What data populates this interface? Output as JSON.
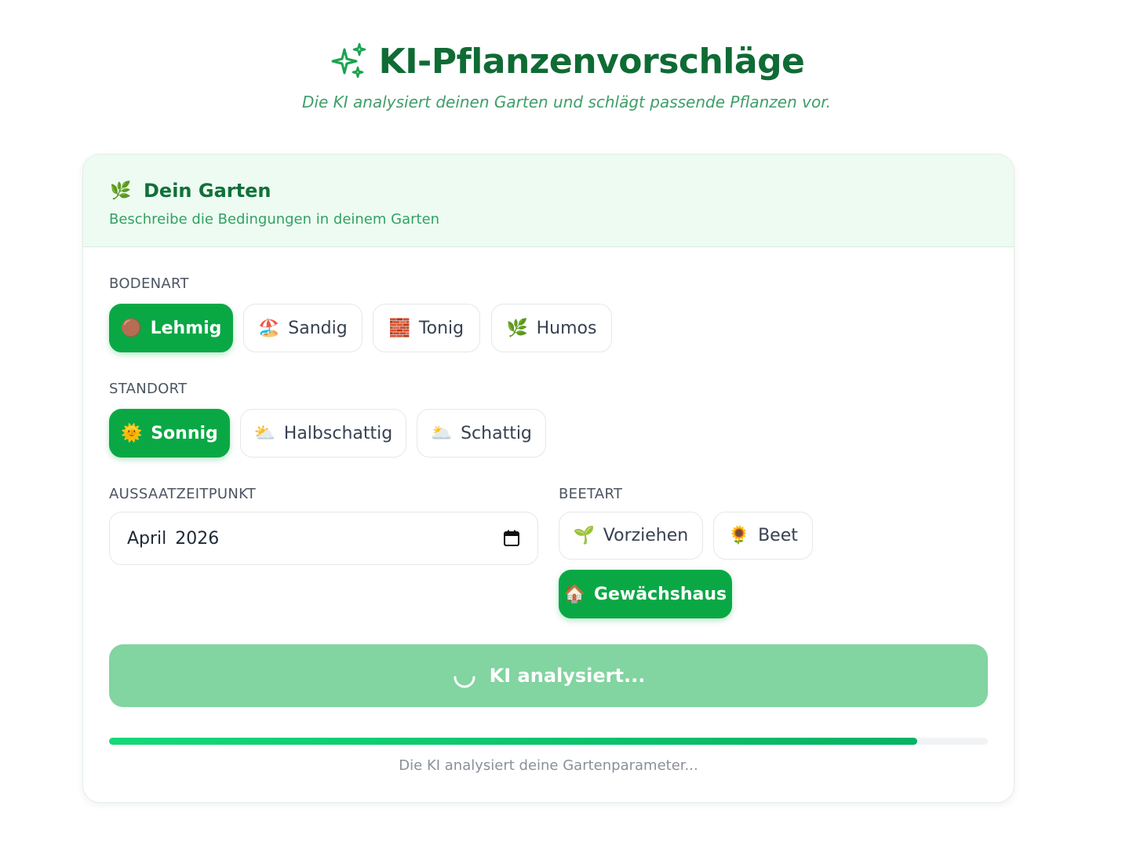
{
  "header": {
    "icon": "sparkles-icon",
    "title": "KI-Pflanzenvorschläge",
    "subtitle": "Die KI analysiert deinen Garten und schlägt passende Pflanzen vor."
  },
  "card": {
    "icon": "🌿",
    "title": "Dein Garten",
    "description": "Beschreibe die Bedingungen in deinem Garten"
  },
  "soil": {
    "label": "BODENART",
    "options": [
      {
        "emoji": "🟤",
        "label": "Lehmig",
        "active": true
      },
      {
        "emoji": "🏖️",
        "label": "Sandig",
        "active": false
      },
      {
        "emoji": "🧱",
        "label": "Tonig",
        "active": false
      },
      {
        "emoji": "🌿",
        "label": "Humos",
        "active": false
      }
    ]
  },
  "location": {
    "label": "STANDORT",
    "options": [
      {
        "emoji": "🌞",
        "label": "Sonnig",
        "active": true
      },
      {
        "emoji": "⛅",
        "label": "Halbschattig",
        "active": false
      },
      {
        "emoji": "🌥️",
        "label": "Schattig",
        "active": false
      }
    ]
  },
  "sowing": {
    "label": "AUSSAATZEITPUNKT",
    "value": "April 2026",
    "icon": "calendar-icon"
  },
  "bed": {
    "label": "BEETART",
    "options": [
      {
        "emoji": "🌱",
        "label": "Vorziehen",
        "active": false
      },
      {
        "emoji": "🌻",
        "label": "Beet",
        "active": false
      },
      {
        "emoji": "🏠",
        "label": "Gewächshaus",
        "active": true
      }
    ]
  },
  "submit": {
    "label": "KI analysiert...",
    "icon": "spinner-icon"
  },
  "progress": {
    "fraction": 0.92,
    "text": "Die KI analysiert deine Gartenparameter..."
  },
  "colors": {
    "accent": "#0aa845",
    "title": "#0f6b34",
    "progress": "#05b364"
  }
}
